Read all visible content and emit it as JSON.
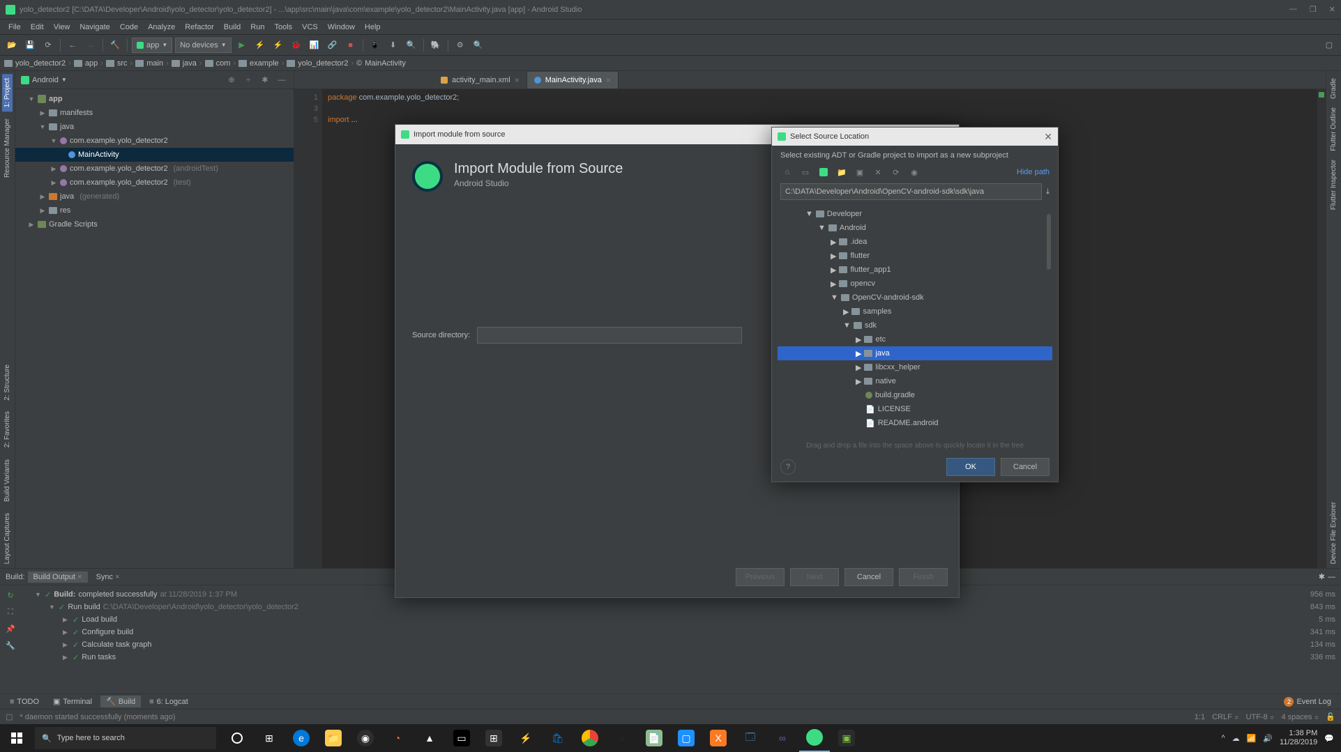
{
  "window": {
    "title": "yolo_detector2 [C:\\DATA\\Developer\\Android\\yolo_detector\\yolo_detector2] - ...\\app\\src\\main\\java\\com\\example\\yolo_detector2\\MainActivity.java [app] - Android Studio"
  },
  "menubar": [
    "File",
    "Edit",
    "View",
    "Navigate",
    "Code",
    "Analyze",
    "Refactor",
    "Build",
    "Run",
    "Tools",
    "VCS",
    "Window",
    "Help"
  ],
  "toolbar": {
    "app_combo": "app",
    "device_combo": "No devices"
  },
  "breadcrumbs": [
    "yolo_detector2",
    "app",
    "src",
    "main",
    "java",
    "com",
    "example",
    "yolo_detector2",
    "MainActivity"
  ],
  "project_panel": {
    "mode": "Android",
    "tree": {
      "app": "app",
      "manifests": "manifests",
      "java": "java",
      "pkg1": "com.example.yolo_detector2",
      "main_activity": "MainActivity",
      "pkg2": "com.example.yolo_detector2",
      "pkg2_suffix": "(androidTest)",
      "pkg3": "com.example.yolo_detector2",
      "pkg3_suffix": "(test)",
      "java_gen": "java",
      "java_gen_suffix": "(generated)",
      "res": "res",
      "gradle_scripts": "Gradle Scripts"
    }
  },
  "left_gutter": {
    "project": "1: Project",
    "resmgr": "Resource Manager",
    "structure": "2: Structure",
    "favorites": "2: Favorites",
    "buildvar": "Build Variants",
    "layout": "Layout Captures"
  },
  "right_gutter": {
    "gradle": "Gradle",
    "flutter": "Flutter Outline",
    "flutteri": "Flutter Inspector",
    "devexp": "Device File Explorer"
  },
  "editor": {
    "tabs": [
      {
        "label": "activity_main.xml",
        "type": "xml"
      },
      {
        "label": "MainActivity.java",
        "type": "java",
        "active": true
      }
    ],
    "lines": {
      "1": "1",
      "2": "3",
      "3": "5"
    },
    "code": {
      "l1_kw": "package",
      "l1_rest": " com.example.yolo_detector2;",
      "l3_kw": "import",
      "l3_rest": " ..."
    }
  },
  "dialog_import": {
    "title": "Import module from source",
    "heading": "Import Module from Source",
    "subtitle": "Android Studio",
    "field_label": "Source directory:",
    "buttons": {
      "previous": "Previous",
      "next": "Next",
      "cancel": "Cancel",
      "finish": "Finish"
    }
  },
  "dialog_source": {
    "title": "Select Source Location",
    "hint": "Select existing ADT or Gradle project to import as a new subproject",
    "hide_path": "Hide path",
    "path": "C:\\DATA\\Developer\\Android\\OpenCV-android-sdk\\sdk\\java",
    "tree": {
      "developer": "Developer",
      "android": "Android",
      "idea": ".idea",
      "flutter": "flutter",
      "flutter_app1": "flutter_app1",
      "opencv": "opencv",
      "opencv_sdk": "OpenCV-android-sdk",
      "samples": "samples",
      "sdk": "sdk",
      "etc": "etc",
      "java": "java",
      "libcxx": "libcxx_helper",
      "native": "native",
      "build_gradle": "build.gradle",
      "license": "LICENSE",
      "readme": "README.android"
    },
    "dnd_hint": "Drag and drop a file into the space above to quickly locate it in the tree",
    "buttons": {
      "ok": "OK",
      "cancel": "Cancel"
    }
  },
  "build_panel": {
    "label": "Build:",
    "tabs": {
      "output": "Build Output",
      "sync": "Sync"
    },
    "rows": {
      "r1": "Build:",
      "r1b": " completed successfully",
      "r1t": " at 11/28/2019 1:37 PM",
      "r2": "Run build",
      "r2t": " C:\\DATA\\Developer\\Android\\yolo_detector\\yolo_detector2",
      "r3": "Load build",
      "r4": "Configure build",
      "r5": "Calculate task graph",
      "r6": "Run tasks"
    },
    "times": [
      "956 ms",
      "843 ms",
      "5 ms",
      "341 ms",
      "134 ms",
      "336 ms"
    ]
  },
  "bottom_tool": {
    "todo": "TODO",
    "terminal": "Terminal",
    "build": "Build",
    "logcat": "6: Logcat",
    "event_log": "Event Log",
    "event_count": "2"
  },
  "status_bar": {
    "msg": "* daemon started successfully (moments ago)",
    "pos": "1:1",
    "eol": "CRLF",
    "enc": "UTF-8",
    "indent": "4 spaces"
  },
  "taskbar": {
    "search_placeholder": "Type here to search",
    "time": "1:38 PM",
    "date": "11/28/2019"
  }
}
